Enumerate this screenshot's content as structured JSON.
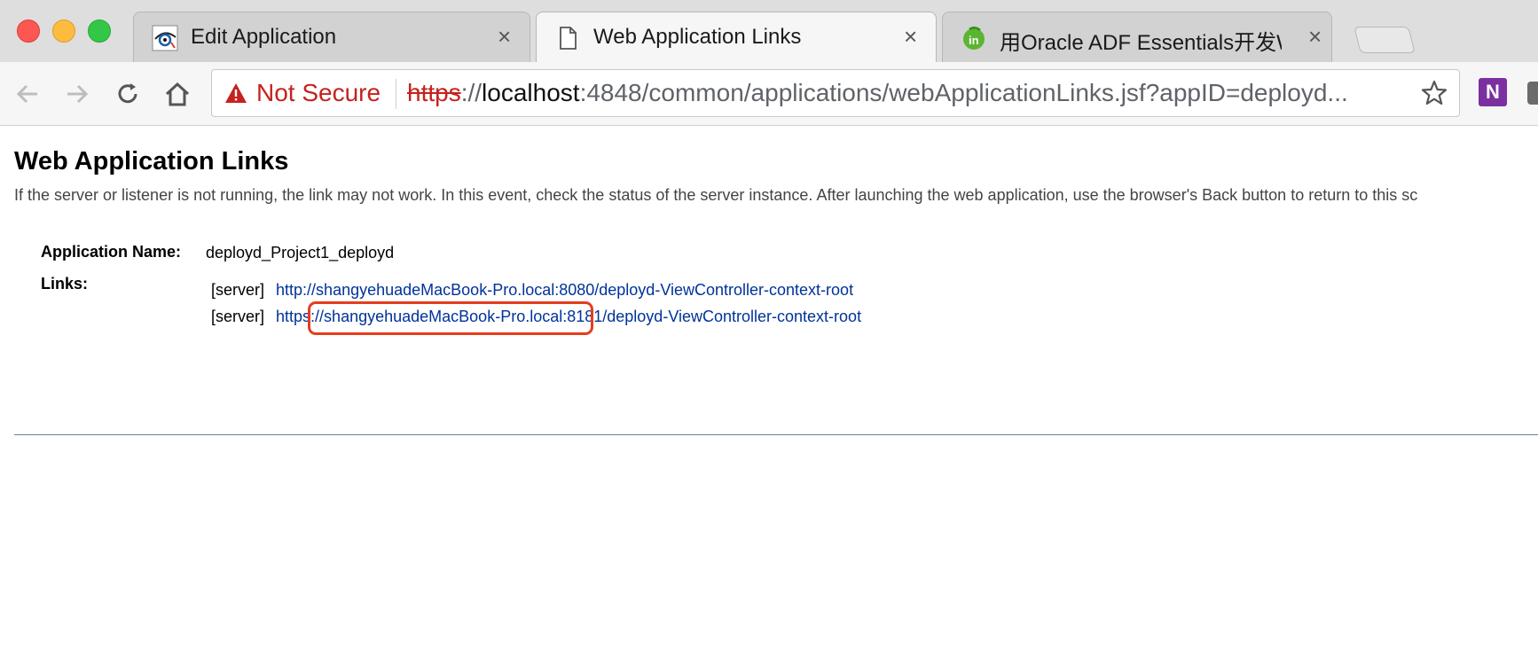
{
  "browser": {
    "tabs": [
      {
        "title": "Edit Application",
        "close": "×",
        "favicon": "glassfish-icon"
      },
      {
        "title": "Web Application Links",
        "close": "×",
        "favicon": "page-icon"
      },
      {
        "title": "用Oracle ADF Essentials开发We",
        "close": "×",
        "favicon": "infoq-icon"
      }
    ],
    "security_label": "Not Secure",
    "url": {
      "scheme": "https",
      "separator": "://",
      "host": "localhost",
      "rest": ":4848/common/applications/webApplicationLinks.jsf?appID=deployd..."
    },
    "extension_label": "N"
  },
  "page": {
    "title": "Web Application Links",
    "help": "If the server or listener is not running, the link may not work. In this event, check the status of the server instance. After launching the web application, use the browser's Back button to return to this sc",
    "app_name_label": "Application Name:",
    "app_name_value": "deployd_Project1_deployd",
    "links_label": "Links:",
    "links": [
      {
        "tag": "[server]",
        "url": "http://shangyehuadeMacBook-Pro.local:8080/deployd-ViewController-context-root"
      },
      {
        "tag": "[server]",
        "url": "https://shangyehuadeMacBook-Pro.local:8181/deployd-ViewController-context-root"
      }
    ]
  },
  "colors": {
    "highlight": "#e53d1f",
    "link": "#003399",
    "not_secure": "#c5221f"
  }
}
